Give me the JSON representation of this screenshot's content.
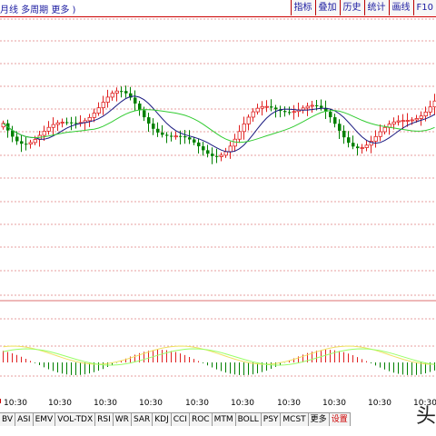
{
  "header": {
    "title": "月线  多周期  更多 )",
    "buttons": [
      "指标",
      "叠加",
      "历史",
      "统计",
      "画线",
      "F10"
    ]
  },
  "time_labels": [
    "10:30",
    "10:30",
    "10:30",
    "10:30",
    "10:30",
    "10:30",
    "10:30",
    "10:30",
    "10:30",
    "10:30"
  ],
  "footer": {
    "tabs": [
      "BV",
      "ASI",
      "EMV",
      "VOL-TDX",
      "RSI",
      "WR",
      "SAR",
      "KDJ",
      "CCI",
      "ROC",
      "MTM",
      "BOLL",
      "PSY",
      "MCST",
      "更多",
      "设置"
    ],
    "watermark": "头"
  },
  "colors": {
    "up": "#e02020",
    "down": "#008000",
    "ma_short": "#1a1a80",
    "ma_long": "#33cc33",
    "grid": "#d04040",
    "macd_dif": "#f0e060",
    "macd_dea": "#99ff66"
  }
}
